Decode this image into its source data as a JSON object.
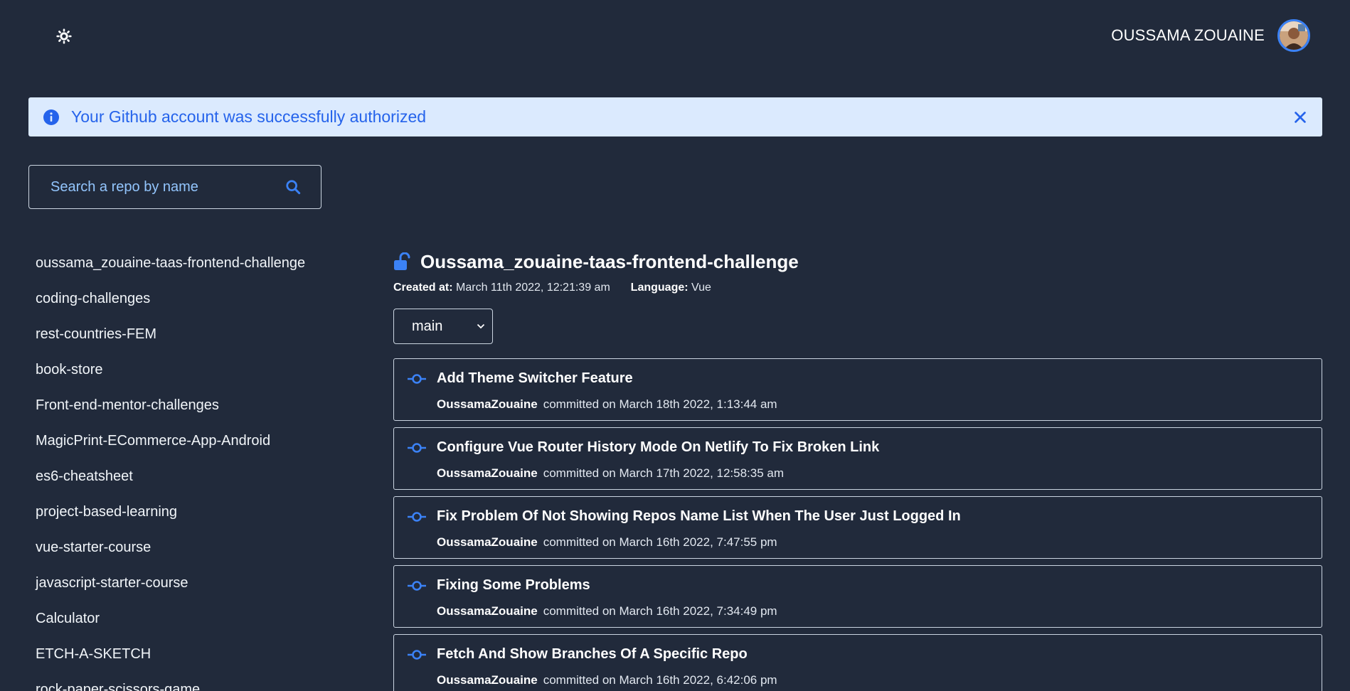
{
  "header": {
    "theme_icon": "sun-gear-icon",
    "user_name": "OUSSAMA ZOUAINE"
  },
  "alert": {
    "icon": "info-icon",
    "text": "Your Github account was successfully authorized",
    "close_icon": "close-icon"
  },
  "search": {
    "placeholder": "Search a repo by name",
    "value": ""
  },
  "repos": [
    "oussama_zouaine-taas-frontend-challenge",
    "coding-challenges",
    "rest-countries-FEM",
    "book-store",
    "Front-end-mentor-challenges",
    "MagicPrint-ECommerce-App-Android",
    "es6-cheatsheet",
    "project-based-learning",
    "vue-starter-course",
    "javascript-starter-course",
    "Calculator",
    "ETCH-A-SKETCH",
    "rock-paper-scissors-game"
  ],
  "repo_detail": {
    "title": "Oussama_zouaine-taas-frontend-challenge",
    "created_label": "Created at:",
    "created_value": "March 11th 2022, 12:21:39 am",
    "language_label": "Language:",
    "language_value": "Vue",
    "branch": "main"
  },
  "commits": [
    {
      "message": "Add Theme Switcher Feature",
      "author": "OussamaZouaine",
      "date": "committed on March 18th 2022, 1:13:44 am"
    },
    {
      "message": "Configure Vue Router History Mode On Netlify To Fix Broken Link",
      "author": "OussamaZouaine",
      "date": "committed on March 17th 2022, 12:58:35 am"
    },
    {
      "message": "Fix Problem Of Not Showing Repos Name List When The User Just Logged In",
      "author": "OussamaZouaine",
      "date": "committed on March 16th 2022, 7:47:55 pm"
    },
    {
      "message": "Fixing Some Problems",
      "author": "OussamaZouaine",
      "date": "committed on March 16th 2022, 7:34:49 pm"
    },
    {
      "message": "Fetch And Show Branches Of A Specific Repo",
      "author": "OussamaZouaine",
      "date": "committed on March 16th 2022, 6:42:06 pm"
    }
  ],
  "colors": {
    "background": "#212a3b",
    "accent": "#3b82f6",
    "alert_bg": "#dbeafe",
    "alert_text": "#2563eb"
  }
}
